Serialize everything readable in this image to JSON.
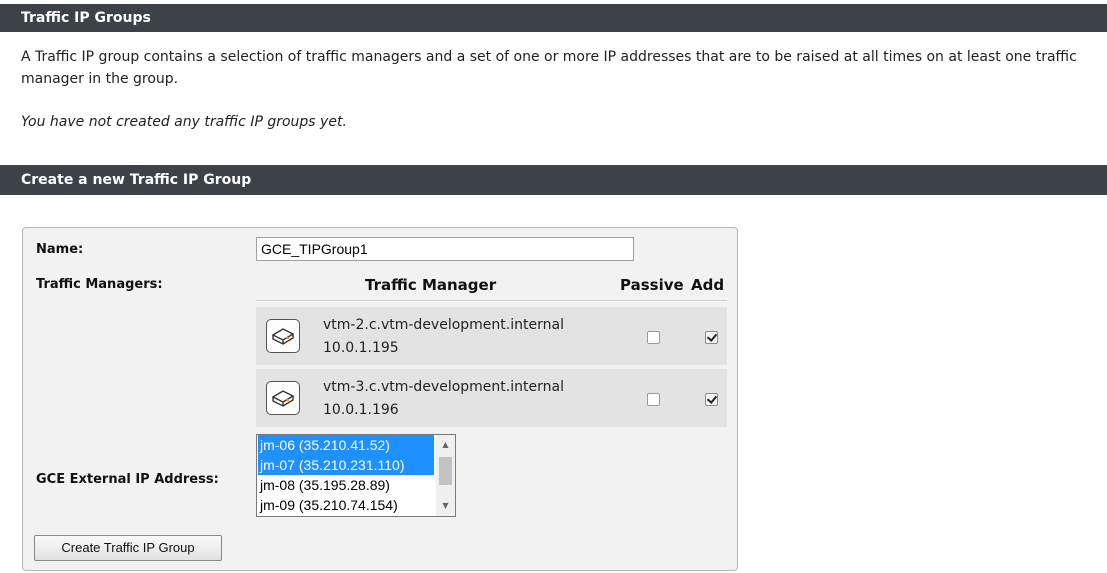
{
  "section1": {
    "title": "Traffic IP Groups",
    "description": "A Traffic IP group contains a selection of traffic managers and a set of one or more IP addresses that are to be raised at all times on at least one traffic manager in the group.",
    "empty_note": "You have not created any traffic IP groups yet."
  },
  "section2": {
    "title": "Create a new Traffic IP Group"
  },
  "form": {
    "name_label": "Name:",
    "name_value": "GCE_TIPGroup1",
    "tm_label": "Traffic Managers:",
    "headers": {
      "tm": "Traffic Manager",
      "passive": "Passive",
      "add": "Add"
    },
    "managers": [
      {
        "host": "vtm-2.c.vtm-development.internal",
        "ip": "10.0.1.195",
        "passive": false,
        "add": true,
        "icon": "server-icon"
      },
      {
        "host": "vtm-3.c.vtm-development.internal",
        "ip": "10.0.1.196",
        "passive": false,
        "add": true,
        "icon": "server-icon"
      }
    ],
    "ip_label": "GCE External IP Address:",
    "ip_options": [
      {
        "text": "jm-06 (35.210.41.52)",
        "selected": true
      },
      {
        "text": "jm-07 (35.210.231.110)",
        "selected": true
      },
      {
        "text": "jm-08 (35.195.28.89)",
        "selected": false
      },
      {
        "text": "jm-09 (35.210.74.154)",
        "selected": false
      }
    ],
    "create_button": "Create Traffic IP Group"
  },
  "colors": {
    "header_bg": "#3c4247",
    "selection": "#1e90ff",
    "panel_bg": "#f2f2f2",
    "row_bg": "#e3e3e3"
  }
}
